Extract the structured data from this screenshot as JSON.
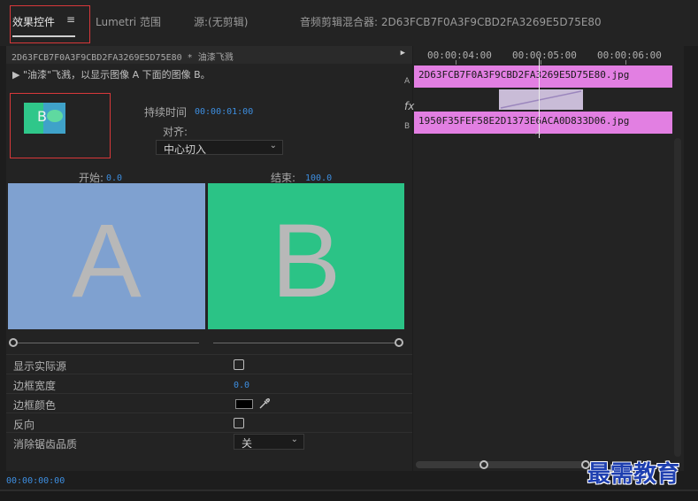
{
  "tabs": [
    {
      "label": "效果控件",
      "active": true
    },
    {
      "label": "Lumetri 范围",
      "active": false
    },
    {
      "label": "源:(无剪辑)",
      "active": false
    },
    {
      "label": "音频剪辑混合器: 2D63FCB7F0A3F9CBD2FA3269E5D75E80",
      "active": false
    }
  ],
  "menu_icon": "hamburger-menu-icon",
  "clip_header": "2D63FCB7F0A3F9CBD2FA3269E5D75E80 * 油漆飞溅",
  "description": "▶  \"油漆\"飞溅，以显示图像 A 下面的图像 B。",
  "duration": {
    "label": "持续时间",
    "value": "00:00:01:00"
  },
  "alignment": {
    "label": "对齐:",
    "value": "中心切入"
  },
  "start": {
    "label": "开始:",
    "value": "0.0"
  },
  "end": {
    "label": "结束:",
    "value": "100.0"
  },
  "preview": {
    "a_letter": "A",
    "b_letter": "B",
    "a_color": "#7fa1d0",
    "b_color": "#2bc386",
    "thumb_letter": "B"
  },
  "settings": [
    {
      "label": "显示实际源",
      "type": "checkbox",
      "checked": false
    },
    {
      "label": "边框宽度",
      "type": "number",
      "value": "0.0"
    },
    {
      "label": "边框颜色",
      "type": "color",
      "value": "#000000"
    },
    {
      "label": "反向",
      "type": "checkbox",
      "checked": false
    },
    {
      "label": "消除锯齿品质",
      "type": "select",
      "value": "关"
    }
  ],
  "timeline": {
    "ruler": [
      "00:00:04:00",
      "00:00:05:00",
      "00:00:06:00"
    ],
    "track_a_letter": "A",
    "track_b_letter": "B",
    "clip_a": "2D63FCB7F0A3F9CBD2FA3269E5D75E80.jpg",
    "clip_b": "1950F35FEF58E2D1373E6ACA0D833D06.jpg",
    "fx_label": "fx",
    "clip_color": "#e27fe2"
  },
  "current_time": "00:00:00:00",
  "watermark": "最需教育"
}
